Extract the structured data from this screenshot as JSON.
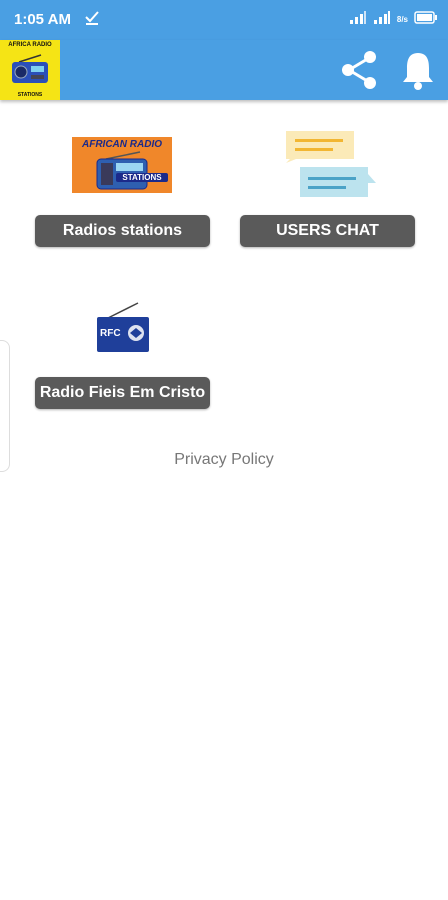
{
  "status_bar": {
    "time": "1:05 AM",
    "speed": "8/s"
  },
  "toolbar": {
    "logo": {
      "top_text": "AFRICA RADIO",
      "bottom_text": "STATIONS"
    },
    "icons": [
      "share-icon",
      "bell-icon"
    ]
  },
  "tiles": [
    {
      "image_text_top": "AFRICAN RADIO",
      "image_text_bottom": "STATIONS",
      "button_label": "Radios stations"
    },
    {
      "button_label": "USERS CHAT"
    },
    {
      "image_text": "RFC",
      "button_label": "Radio Fieis Em Cristo"
    }
  ],
  "privacy_policy": "Privacy Policy",
  "colors": {
    "header": "#4a9fe3",
    "button": "#5a5a5a",
    "logo_bg": "#f5e415"
  }
}
